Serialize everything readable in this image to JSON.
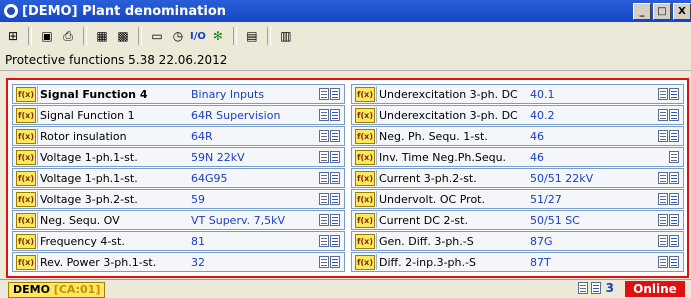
{
  "window": {
    "title": "[DEMO]  Plant denomination",
    "min_label": "_",
    "max_label": "□",
    "close_label": "X"
  },
  "toolbar": {
    "icons": [
      "tree-icon",
      "save-icon",
      "print-icon",
      "grid-icon",
      "grid-alt-icon",
      "display-icon",
      "clock-icon",
      "io-icon",
      "settings-icon",
      "chart-icon",
      "report-icon"
    ],
    "io_label": "I/O"
  },
  "header": {
    "subtitle": "Protective functions  5.38   22.06.2012"
  },
  "functions": {
    "left": [
      {
        "name": "Signal Function 4",
        "value": "Binary Inputs",
        "bold": true
      },
      {
        "name": "Signal Function 1",
        "value": "64R Supervision"
      },
      {
        "name": "Rotor insulation",
        "value": "64R"
      },
      {
        "name": "Voltage 1-ph.1-st.",
        "value": "59N 22kV"
      },
      {
        "name": "Voltage 1-ph.1-st.",
        "value": "64G95"
      },
      {
        "name": "Voltage 3-ph.2-st.",
        "value": "59"
      },
      {
        "name": "Neg. Sequ. OV",
        "value": "VT Superv. 7,5kV"
      },
      {
        "name": "Frequency 4-st.",
        "value": "81"
      },
      {
        "name": "Rev. Power 3-ph.1-st.",
        "value": "32"
      }
    ],
    "right": [
      {
        "name": "Underexcitation 3-ph. DC",
        "value": "40.1"
      },
      {
        "name": "Underexcitation 3-ph. DC",
        "value": "40.2"
      },
      {
        "name": "Neg. Ph. Sequ. 1-st.",
        "value": "46"
      },
      {
        "name": "Inv. Time Neg.Ph.Sequ.",
        "value": "46"
      },
      {
        "name": "Current 3-ph.2-st.",
        "value": "50/51 22kV"
      },
      {
        "name": "Undervolt. OC Prot.",
        "value": "51/27"
      },
      {
        "name": "Current DC 2-st.",
        "value": "50/51 SC"
      },
      {
        "name": "Gen. Diff. 3-ph.-S",
        "value": "87G"
      },
      {
        "name": "Diff. 2-inp.3-ph.-S",
        "value": "87T"
      }
    ],
    "fx_label": "f(x)"
  },
  "statusbar": {
    "device": "DEMO",
    "code": "[CA:01]",
    "count": "3",
    "state": "Online"
  },
  "colors": {
    "accent_blue": "#1a3fc0",
    "frame_red": "#e01010",
    "online_red": "#e01010",
    "fx_yellow": "#ffe860"
  }
}
